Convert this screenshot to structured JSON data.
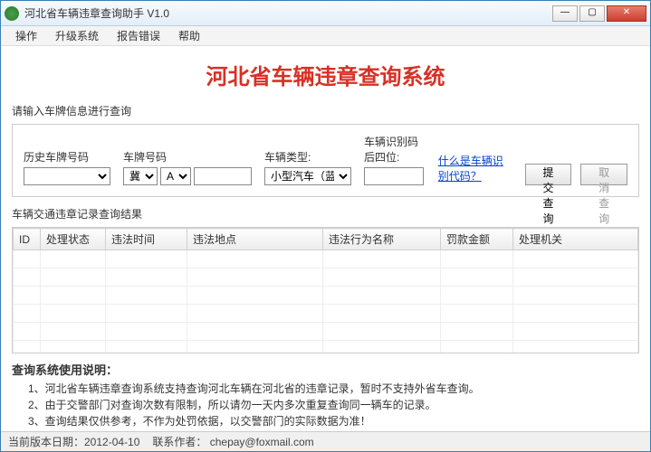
{
  "window": {
    "title": "河北省车辆违章查询助手 V1.0"
  },
  "menu": {
    "operate": "操作",
    "upgrade": "升级系统",
    "report": "报告错误",
    "help": "帮助"
  },
  "mainTitle": "河北省车辆违章查询系统",
  "querySection": {
    "prompt": "请输入车牌信息进行查询",
    "historyLabel": "历史车牌号码",
    "plateLabel": "车牌号码",
    "provValue": "冀",
    "letterValue": "A",
    "typeLabel": "车辆类型:",
    "typeValue": "小型汽车（蓝牌）",
    "vinLabel": "车辆识别码后四位:",
    "link": "什么是车辆识别代码？",
    "submit": "提交查询",
    "cancel": "取消查询"
  },
  "results": {
    "label": "车辆交通违章记录查询结果",
    "cols": {
      "id": "ID",
      "status": "处理状态",
      "time": "违法时间",
      "loc": "违法地点",
      "act": "违法行为名称",
      "fine": "罚款金额",
      "org": "处理机关"
    }
  },
  "instructions": {
    "title": "查询系统使用说明：",
    "l1": "1、河北省车辆违章查询系统支持查询河北车辆在河北省的违章记录，暂时不支持外省车查询。",
    "l2": "2、由于交警部门对查询次数有限制，所以请勿一天内多次重复查询同一辆车的记录。",
    "l3": "3、查询结果仅供参考，不作为处罚依据，以交警部门的实际数据为准！"
  },
  "status": {
    "version": "当前版本日期：2012-04-10",
    "contact": "联系作者： chepay@foxmail.com"
  }
}
